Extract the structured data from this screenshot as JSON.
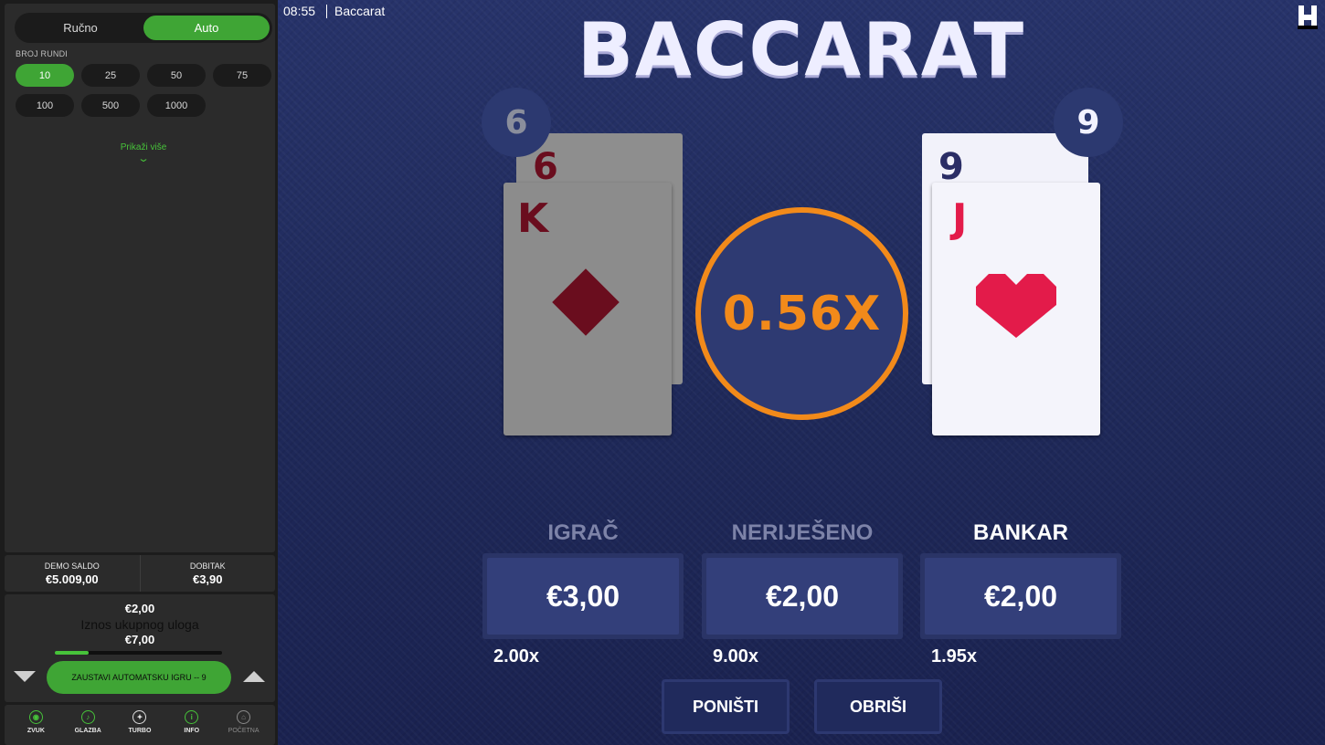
{
  "left_panel": {
    "mode_tabs": [
      {
        "label": "Ručno",
        "active": false
      },
      {
        "label": "Auto",
        "active": true
      }
    ],
    "rounds_label": "BROJ RUNDI",
    "rounds_options": [
      "10",
      "25",
      "50",
      "75",
      "100",
      "500",
      "1000"
    ],
    "rounds_selected": "10",
    "show_more_label": "Prikaži više",
    "balance": {
      "label": "DEMO SALDO",
      "value": "€5.009,00"
    },
    "win": {
      "label": "DOBITAK",
      "value": "€3,90"
    },
    "bet": {
      "top_amount": "€2,00",
      "label": "Iznos ukupnog uloga",
      "total_amount": "€7,00",
      "progress": 0.2
    },
    "stop_button_label": "ZAUSTAVI AUTOMATSKU IGRU -- 9",
    "footer": [
      {
        "label": "ZVUK",
        "icon": "sound-icon",
        "glyph": "◉"
      },
      {
        "label": "GLAZBA",
        "icon": "music-icon",
        "glyph": "♪"
      },
      {
        "label": "TURBO",
        "icon": "turbo-icon",
        "glyph": "✦"
      },
      {
        "label": "INFO",
        "icon": "info-icon",
        "glyph": "i"
      },
      {
        "label": "POČETNA",
        "icon": "home-icon",
        "glyph": "⌂"
      }
    ]
  },
  "topbar": {
    "time": "08:55",
    "title": "Baccarat"
  },
  "game": {
    "title": "BACCARAT",
    "player_score": "6",
    "banker_score": "9",
    "player_cards": [
      {
        "rank": "6",
        "suit": "diamonds"
      },
      {
        "rank": "K",
        "suit": "diamonds"
      }
    ],
    "banker_cards": [
      {
        "rank": "9",
        "suit": "spades"
      },
      {
        "rank": "J",
        "suit": "hearts"
      }
    ],
    "multiplier": "0.56X",
    "bets": [
      {
        "name": "IGRAČ",
        "amount": "€3,00",
        "payout": "2.00x",
        "highlight": false
      },
      {
        "name": "NERIJEŠENO",
        "amount": "€2,00",
        "payout": "9.00x",
        "highlight": false
      },
      {
        "name": "BANKAR",
        "amount": "€2,00",
        "payout": "1.95x",
        "highlight": true
      }
    ],
    "undo_label": "PONIŠTI",
    "clear_label": "OBRIŠI"
  },
  "colors": {
    "accent_green": "#3fa535",
    "multiplier_orange": "#f28a1a",
    "heart_red": "#e31b4a",
    "diamond_dark_red": "#6a0d1e"
  }
}
